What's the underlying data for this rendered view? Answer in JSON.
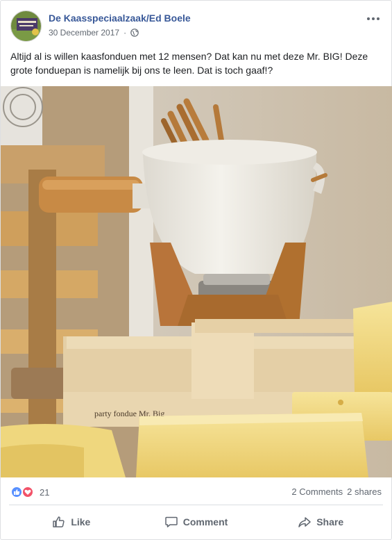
{
  "post": {
    "page_name": "De Kaasspeciaalzaak/Ed Boele",
    "date": "30 December 2017",
    "date_separator": "·",
    "audience_icon": "globe-icon",
    "text": "Altijd al is willen kaasfonduen met 12 mensen? Dat kan nu met deze Mr. BIG! Deze grote fonduepan is namelijk bij ons te leen. Dat is toch gaaf!?",
    "photo_box_text": "party fondue Mr. Big"
  },
  "reactions": {
    "count": "21",
    "types": [
      "like",
      "love"
    ]
  },
  "stats": {
    "comments": "2 Comments",
    "shares": "2 shares"
  },
  "actions": {
    "like": "Like",
    "comment": "Comment",
    "share": "Share"
  },
  "colors": {
    "link": "#385898",
    "meta": "#606770",
    "like_blue": "#5890ff",
    "love_red": "#f25268"
  }
}
